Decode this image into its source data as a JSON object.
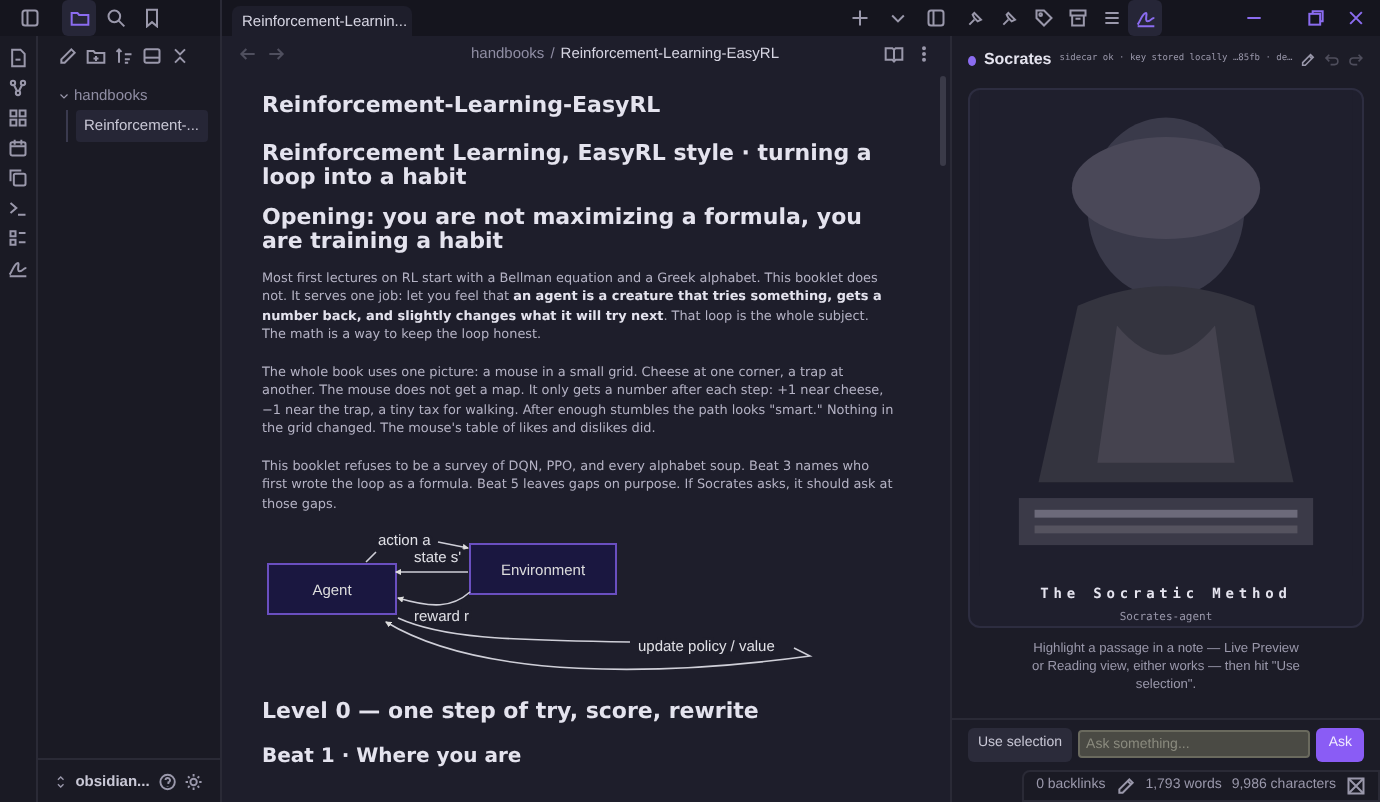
{
  "tabs": [
    {
      "label": "Reinforcement-Learnin...",
      "selected": true
    }
  ],
  "breadcrumb": {
    "folder": "handbooks",
    "separator": "/",
    "note": "Reinforcement-Learning-EasyRL"
  },
  "file_tree": [
    {
      "label": "handbooks",
      "expanded": true,
      "selected": false,
      "children": [
        {
          "label": "Reinforcement-...",
          "selected": true
        }
      ]
    }
  ],
  "vault": "obsidian...",
  "note": [
    {
      "kind": "title",
      "text": "Reinforcement-Learning-EasyRL"
    },
    {
      "kind": "h1",
      "text": "Reinforcement Learning, EasyRL style · turning a loop into a habit"
    },
    {
      "kind": "h1",
      "text": "Opening: you are not maximizing a formula, you are training a habit"
    },
    {
      "kind": "p",
      "text": "Most first lectures on RL start with a Bellman equation and a Greek alphabet. This booklet does not. It serves one job: let you feel that **an agent is a creature that tries something, gets a number back, and slightly changes what it will try next**. That loop is the whole subject. The math is a way to keep the loop honest."
    },
    {
      "kind": "p",
      "text": "The whole book uses one picture: a mouse in a small grid. Cheese at one corner, a trap at another. The mouse does not get a map. It only gets a number after each step: +1 near cheese, −1 near the trap, a tiny tax for walking. After enough stumbles the path looks \"smart.\" Nothing in the grid changed. The mouse's table of likes and dislikes did."
    },
    {
      "kind": "p",
      "text": "This booklet refuses to be a survey of DQN, PPO, and every alphabet soup. Beat 3 names who first wrote the loop as a formula. Beat 5 leaves gaps on purpose. If Socrates asks, it should ask at those gaps."
    },
    {
      "kind": "diagram",
      "nodes": [
        "Agent",
        "Environment"
      ],
      "edges": [
        "action a",
        "state s'",
        "reward r",
        "update policy / value"
      ]
    },
    {
      "kind": "h2",
      "text": "Level 0 — one step of try, score, rewrite"
    },
    {
      "kind": "h3",
      "text": "Beat 1 · Where you are"
    }
  ],
  "socrates": {
    "name": "Socrates",
    "status": "sidecar ok · key stored locally …85fb · de…",
    "card_title": "The Socratic Method",
    "card_subtitle": "Socrates-agent",
    "hint": "Highlight a passage in a note — Live Preview or Reading view, either works — then hit \"Use selection\".",
    "use_selection": "Use selection",
    "ask_placeholder": "Ask something...",
    "ask": "Ask"
  },
  "status_bar": {
    "backlinks": "0 backlinks",
    "words": "1,793 words",
    "characters": "9,986 characters"
  }
}
